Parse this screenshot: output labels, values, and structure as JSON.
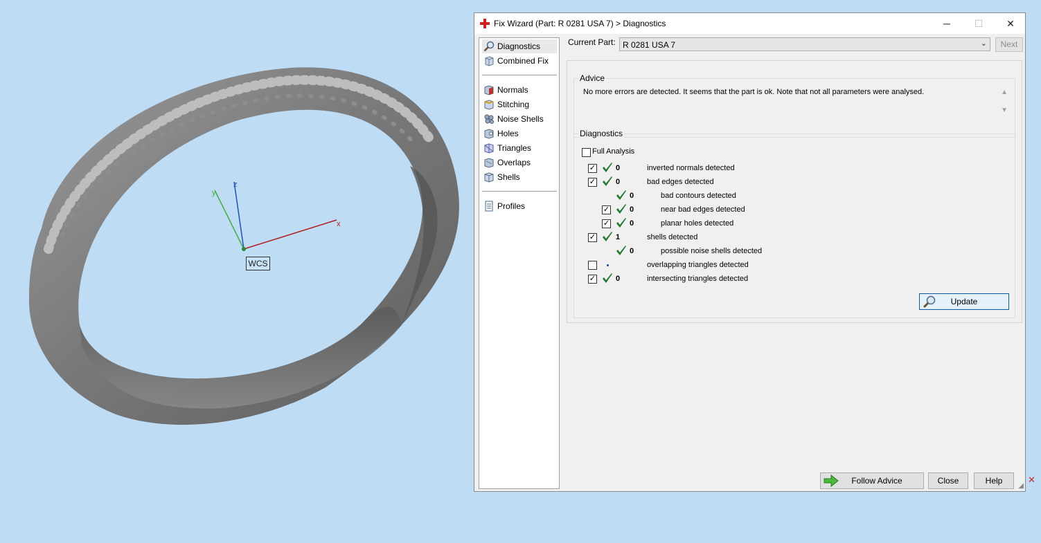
{
  "viewport": {
    "axis_labels": {
      "x": "x",
      "y": "y",
      "z": "z"
    },
    "wcs_label": "WCS",
    "axis_colors": {
      "x": "#b02020",
      "y": "#40b040",
      "z": "#2050c0"
    }
  },
  "window": {
    "title": "Fix Wizard (Part: R 0281 USA 7) > Diagnostics",
    "controls": {
      "minimize": "─",
      "maximize": "☐",
      "close": "✕"
    }
  },
  "nav": {
    "items": [
      {
        "label": "Diagnostics",
        "icon": "magnifier-icon",
        "selected": true
      },
      {
        "label": "Combined Fix",
        "icon": "combined-fix-icon"
      },
      {
        "label": "Normals",
        "icon": "normals-icon"
      },
      {
        "label": "Stitching",
        "icon": "stitching-icon"
      },
      {
        "label": "Noise Shells",
        "icon": "noise-shells-icon"
      },
      {
        "label": "Holes",
        "icon": "holes-icon"
      },
      {
        "label": "Triangles",
        "icon": "triangles-icon"
      },
      {
        "label": "Overlaps",
        "icon": "overlaps-icon"
      },
      {
        "label": "Shells",
        "icon": "shells-icon"
      },
      {
        "label": "Profiles",
        "icon": "profiles-icon"
      }
    ]
  },
  "current_part": {
    "label": "Current Part:",
    "value": "R 0281 USA 7",
    "next_label": "Next"
  },
  "advice": {
    "title": "Advice",
    "text": "No more errors are detected. It seems that the part is ok. Note that not all parameters were analysed."
  },
  "diagnostics": {
    "title": "Diagnostics",
    "full_analysis": {
      "label": "Full Analysis",
      "checked": false
    },
    "rows": [
      {
        "checkbox": true,
        "checked": true,
        "status": "ok",
        "count": "0",
        "text": "inverted normals detected",
        "indent": 0
      },
      {
        "checkbox": true,
        "checked": true,
        "status": "ok",
        "count": "0",
        "text": "bad edges detected",
        "indent": 0
      },
      {
        "checkbox": false,
        "checked": false,
        "status": "ok",
        "count": "0",
        "text": "bad contours detected",
        "indent": 1
      },
      {
        "checkbox": true,
        "checked": true,
        "status": "ok",
        "count": "0",
        "text": "near bad edges detected",
        "indent": 1
      },
      {
        "checkbox": true,
        "checked": true,
        "status": "ok",
        "count": "0",
        "text": "planar holes detected",
        "indent": 1
      },
      {
        "checkbox": true,
        "checked": true,
        "status": "ok",
        "count": "1",
        "text": "shells detected",
        "indent": 0
      },
      {
        "checkbox": false,
        "checked": false,
        "status": "ok",
        "count": "0",
        "text": "possible noise shells detected",
        "indent": 1
      },
      {
        "checkbox": true,
        "checked": false,
        "status": "none",
        "count": "",
        "text": "overlapping triangles detected",
        "indent": 0
      },
      {
        "checkbox": true,
        "checked": true,
        "status": "ok",
        "count": "0",
        "text": "intersecting triangles detected",
        "indent": 0
      }
    ],
    "update_label": "Update"
  },
  "footer": {
    "follow_advice_label": "Follow Advice",
    "close_label": "Close",
    "help_label": "Help"
  },
  "colors": {
    "ok_check": "#1f7a2e",
    "accent": "#0c56b4",
    "background": "#bedcf4"
  }
}
